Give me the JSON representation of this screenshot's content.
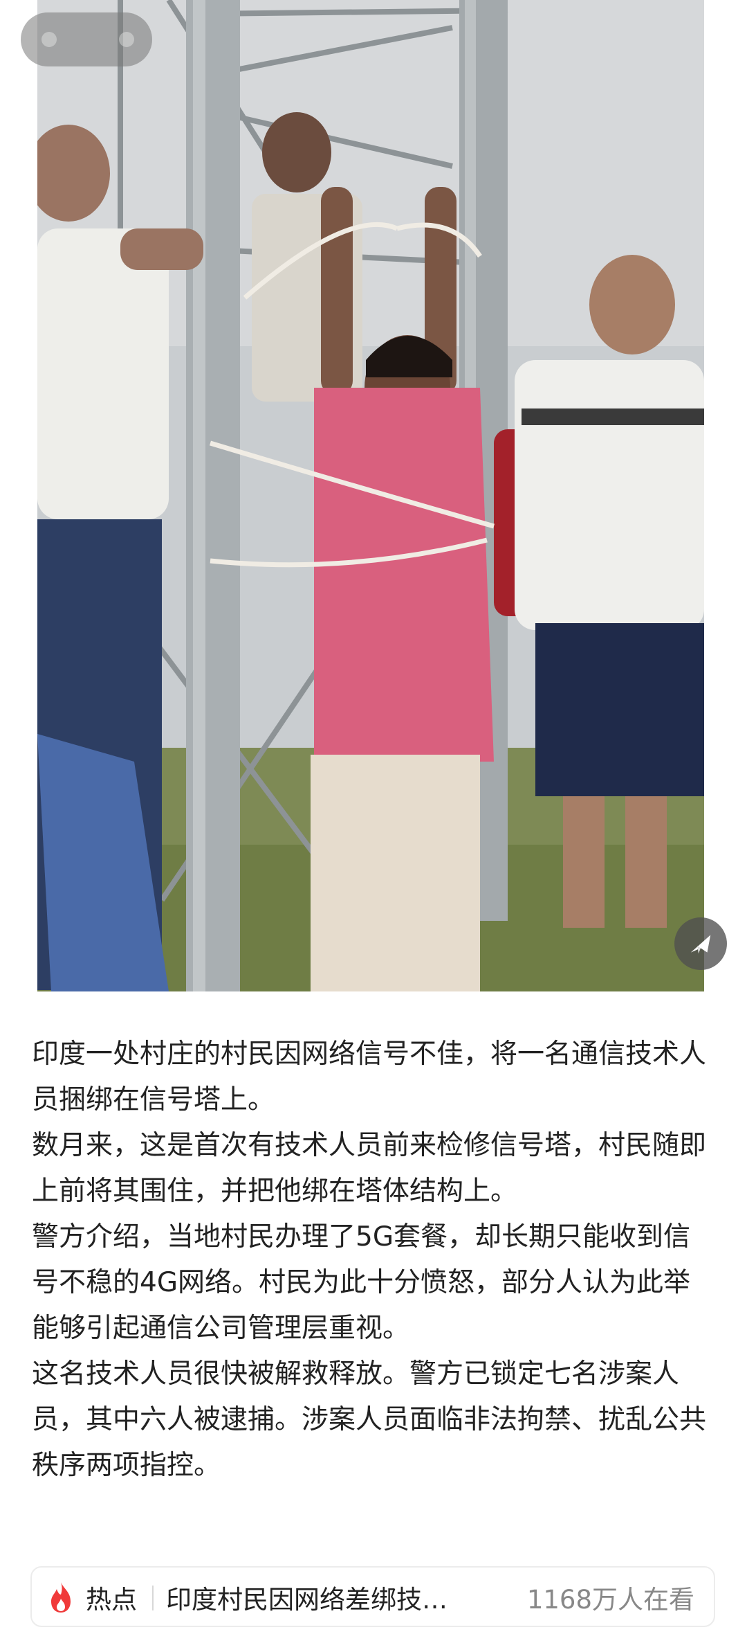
{
  "article": {
    "paragraphs": [
      "印度一处村庄的村民因网络信号不佳，将一名通信技术人员捆绑在信号塔上。",
      "数月来，这是首次有技术人员前来检修信号塔，村民随即上前将其围住，并把他绑在塔体结构上。",
      "警方介绍，当地村民办理了5G套餐，却长期只能收到信号不稳的4G网络。村民为此十分愤怒，部分人认为此举能够引起通信公司管理层重视。",
      "这名技术人员很快被解救释放。警方已锁定七名涉案人员，其中六人被逮捕。涉案人员面临非法拘禁、扰乱公共秩序两项指控。"
    ]
  },
  "hot_bar": {
    "label": "热点",
    "title": "印度村民因网络差绑技…",
    "views": "1168万人在看"
  },
  "icons": {
    "hot": "fire-icon",
    "share": "share-icon"
  },
  "colors": {
    "hot_red": "#f03a3a",
    "text": "#222222",
    "muted": "#888888"
  }
}
